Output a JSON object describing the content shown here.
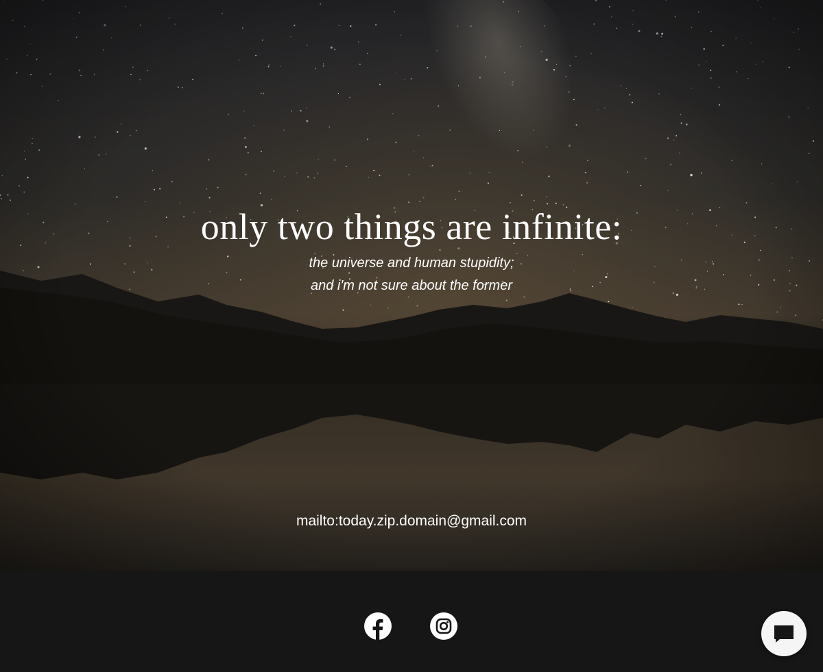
{
  "hero": {
    "title": "only two things are infinite:",
    "subtitle_line1": "the universe and human stupidity;",
    "subtitle_line2": "and i'm not sure about the former",
    "email_link": "mailto:today.zip.domain@gmail.com"
  },
  "footer": {
    "social": [
      {
        "icon": "facebook-icon"
      },
      {
        "icon": "instagram-icon"
      }
    ]
  },
  "chat": {
    "icon": "chat-bubble-icon"
  },
  "colors": {
    "footer_bg": "#161616",
    "text": "#ffffff",
    "chat_button_bg": "#f5f5f5",
    "chat_icon": "#161616"
  }
}
